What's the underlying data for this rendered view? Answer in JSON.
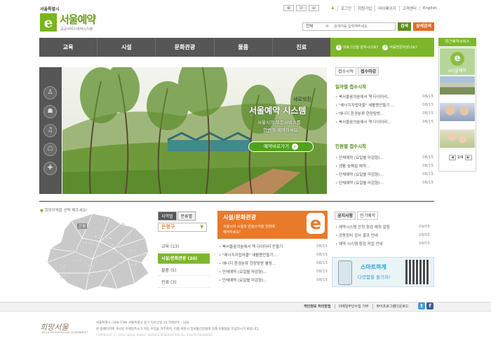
{
  "header": {
    "city_logo": "서울특별시",
    "e_mark": "e",
    "site_title": "서울예약",
    "site_subtitle": "공공서비스예약시스템",
    "util_links": [
      "로그인",
      "회원가입",
      "마이페이지",
      "고객센터",
      "English"
    ],
    "search": {
      "scope": "전체",
      "placeholder": "검색어를 입력해주세요.",
      "search_label": "검색",
      "detail_label": "상세검색"
    }
  },
  "nav": {
    "items": [
      "교육",
      "시설",
      "문화관광",
      "물품",
      "진료"
    ],
    "green_links": [
      "비로그인을 원하시나요?",
      "처음방문하셨나요?"
    ]
  },
  "sidebar": {
    "title": "최근예약서비스",
    "banner_label": "e서울예약",
    "pager": "2/4",
    "colors": {
      "accent": "#7cb72a"
    }
  },
  "hero": {
    "kicker": "새로워진",
    "title": "서울예약 시스템",
    "desc1": "서울시의 모든서비스를",
    "desc2": "한번에 예약하세요",
    "button": "예약바로가기",
    "icons": [
      "education-icon",
      "facility-icon",
      "culture-icon",
      "goods-icon",
      "medical-icon"
    ]
  },
  "rolling": {
    "tabs": [
      "접수시작",
      "접수마감"
    ],
    "daily_heading": "일자별 접수시작",
    "daily": [
      {
        "title": "북서울꿈의숲에서 책 다이어리…",
        "date": "08/15"
      },
      {
        "title": "\"에너지자립마을\" 새활용만들기…",
        "date": "08/15"
      },
      {
        "title": "에너지 환경분류 현장탐방…",
        "date": "08/15"
      },
      {
        "title": "북서울꿈의숲에서 책 다이어리…",
        "date": "08/15"
      }
    ],
    "popular_heading": "인원별 접수시작",
    "popular": [
      {
        "title": "단체예약 (요일별 마감형)…",
        "date": "08/15"
      },
      {
        "title": "생활 숲해설 예약…",
        "date": "08/15"
      },
      {
        "title": "단체예약 (요일별 마감형)…",
        "date": "08/15"
      },
      {
        "title": "단체예약 (요일별 마감형)…",
        "date": "08/15"
      }
    ]
  },
  "region": {
    "map_label": "희망지역을 선택 해주세요!",
    "tabs": [
      "지역별",
      "분류별"
    ],
    "selected": "은평구",
    "categories": [
      "교육 (13)",
      "시설/문화관광 (20)",
      "물품 (5)",
      "진료 (3)"
    ],
    "districts": [
      "은평",
      "도봉",
      "노원",
      "강북",
      "성북",
      "중랑",
      "서대문",
      "종로",
      "동대문",
      "마포",
      "중구",
      "성동",
      "광진",
      "강서",
      "용산",
      "양천",
      "영등포",
      "동작",
      "강남",
      "송파",
      "강동",
      "구로",
      "금천",
      "관악",
      "서초"
    ]
  },
  "culture": {
    "title": "시설/문화관광",
    "desc1": "서울시의 시설과 관광소식을 한번에",
    "desc2": "예약하세요!",
    "list": [
      {
        "title": "북서울꿈의숲에서 책 다이어리 만들기",
        "date": "08/15"
      },
      {
        "title": "\"에너지자립마을\" 새활용만들기…",
        "date": "08/15"
      },
      {
        "title": "에너지 환경분류 현장탐방 활동…",
        "date": "08/15"
      },
      {
        "title": "단체예약 (요일별 마감형)…",
        "date": "08/15"
      },
      {
        "title": "단체예약 (요일별 마감형)…",
        "date": "08/15"
      }
    ]
  },
  "notice": {
    "tabs": [
      "공지사항",
      "인기예약"
    ],
    "list": [
      {
        "title": "예약시스템 안정 점검 예정 알림",
        "date": "09/05"
      },
      {
        "title": "공동장비 검사 결과 안내",
        "date": "09/05"
      },
      {
        "title": "예약 시스템 점검 작업 안내",
        "date": "09/05"
      }
    ],
    "banner1": "스마트하게",
    "banner2": "다양함을 즐기자!"
  },
  "footer": {
    "links": [
      "개인정보 처리방침",
      "이메일무단수집 거부",
      "뷰어프로그램다운로드"
    ],
    "logo": "희망서울",
    "logo_sub": "SEOUL METROPOLITAN GOVERNMENT",
    "address": "서울특별시 (100-739) 서울특별시 중구 덕수궁길 15 전화번호 : 120",
    "notice_line": "본 홈페이지에 게시된 이메일주소가 자동 수집을 거부하며, 이를 위반시 정보통신망법에 의해 처벌됨을 유념하시기 바랍니다.",
    "copyright": "COPYRIGHT (C) 2014 SEOUL PUBLIC SERVICE RESERVATION ALL RIGHTS RESERVED"
  }
}
